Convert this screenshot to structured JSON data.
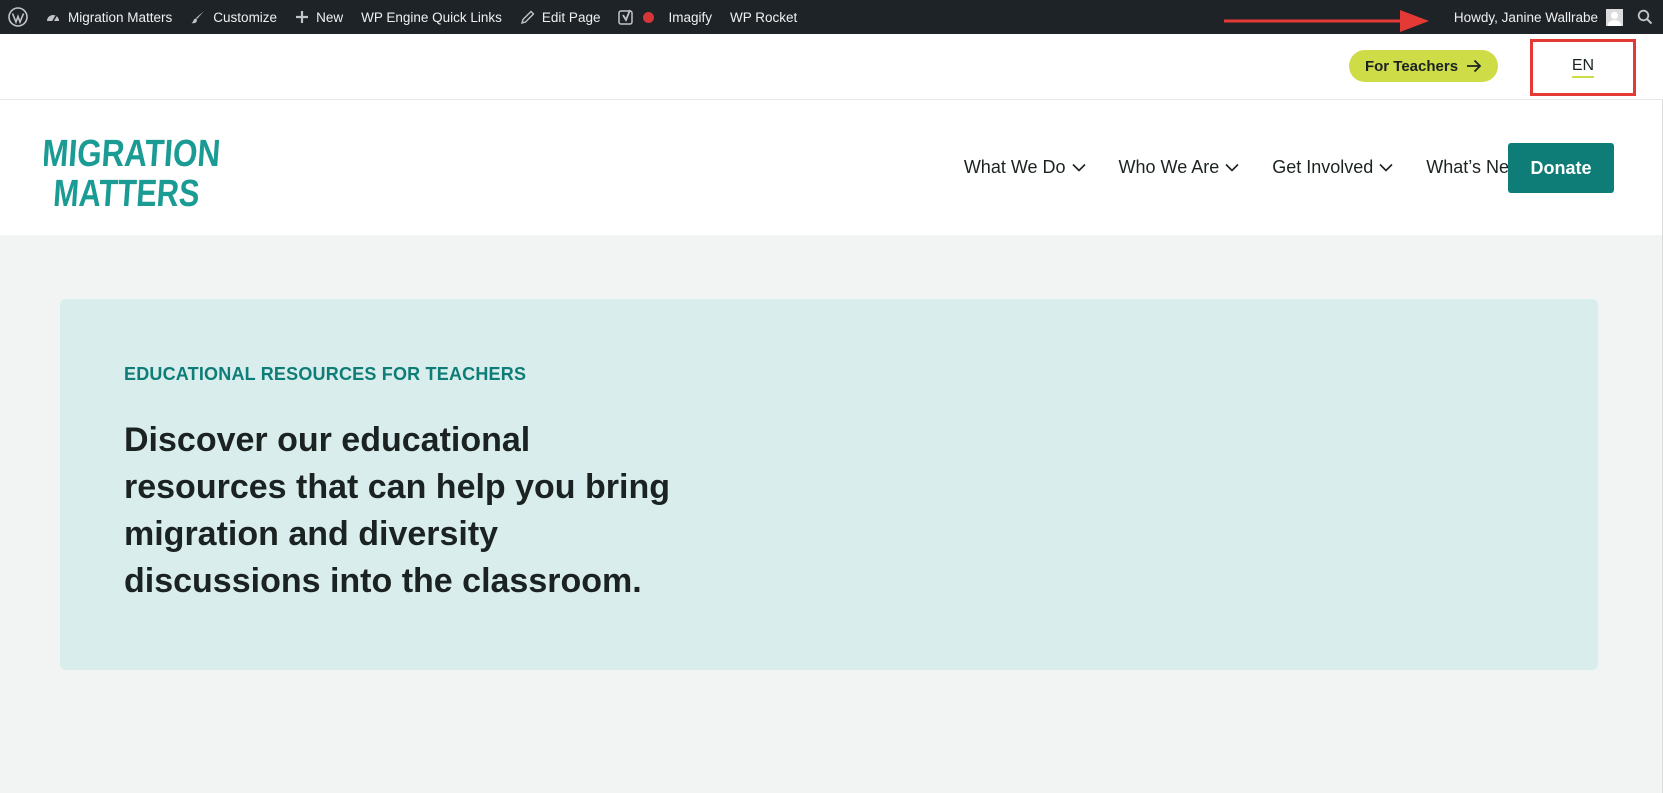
{
  "adminbar": {
    "site_name": "Migration Matters",
    "customize": "Customize",
    "new": "New",
    "quick_links": "WP Engine Quick Links",
    "edit_page": "Edit Page",
    "imagify": "Imagify",
    "wp_rocket": "WP Rocket",
    "howdy": "Howdy, Janine Wallrabe"
  },
  "utility": {
    "teachers_label": "For Teachers",
    "language": "EN"
  },
  "header": {
    "logo_line1": "MIGRATION",
    "logo_line2": "MATTERS",
    "nav": [
      {
        "label": "What We Do"
      },
      {
        "label": "Who We Are"
      },
      {
        "label": "Get Involved"
      },
      {
        "label": "What’s New"
      }
    ],
    "donate": "Donate"
  },
  "hero": {
    "eyebrow": "EDUCATIONAL RESOURCES FOR TEACHERS",
    "title": "Discover our educational resources that can help you bring migration and diversity discussions into the classroom."
  },
  "colors": {
    "admin_bg": "#1d2327",
    "brand_teal": "#0e7d77",
    "accent_lime": "#cddc47",
    "hero_bg": "#d9edec",
    "annotation_red": "#e53935"
  }
}
